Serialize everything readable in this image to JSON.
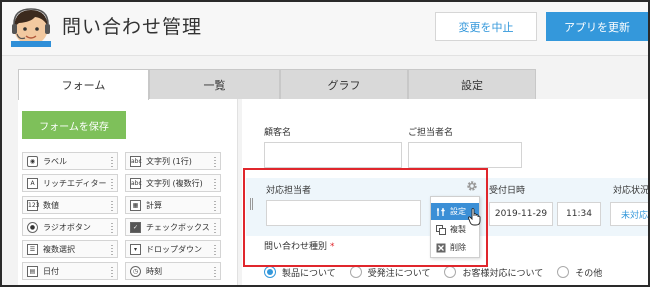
{
  "header": {
    "title": "問い合わせ管理",
    "cancel_label": "変更を中止",
    "update_label": "アプリを更新"
  },
  "tabs": [
    {
      "label": "フォーム",
      "active": true
    },
    {
      "label": "一覧",
      "active": false
    },
    {
      "label": "グラフ",
      "active": false
    },
    {
      "label": "設定",
      "active": false
    }
  ],
  "palette": {
    "save_label": "フォームを保存",
    "items": [
      {
        "label": "ラベル",
        "icon": "label-icon"
      },
      {
        "label": "文字列 (1行)",
        "icon": "abc-icon"
      },
      {
        "label": "リッチエディター",
        "icon": "rich-editor-icon"
      },
      {
        "label": "文字列 (複数行)",
        "icon": "abc-multiline-icon"
      },
      {
        "label": "数値",
        "icon": "number-icon"
      },
      {
        "label": "計算",
        "icon": "calculator-icon"
      },
      {
        "label": "ラジオボタン",
        "icon": "radio-icon"
      },
      {
        "label": "チェックボックス",
        "icon": "checkbox-icon"
      },
      {
        "label": "複数選択",
        "icon": "multi-select-icon"
      },
      {
        "label": "ドロップダウン",
        "icon": "dropdown-icon"
      },
      {
        "label": "日付",
        "icon": "calendar-icon"
      },
      {
        "label": "時刻",
        "icon": "clock-icon"
      }
    ]
  },
  "form": {
    "customer_label": "顧客名",
    "contact_label": "ご担当者名",
    "assignee_label": "対応担当者",
    "received_label": "受付日時",
    "status_label": "対応状況",
    "received_date": "2019-11-29",
    "received_time": "11:34",
    "status_value": "未対応",
    "inquiry_type_label": "問い合わせ種別",
    "required_mark": "*",
    "inquiry_options": [
      {
        "label": "製品について",
        "checked": true
      },
      {
        "label": "受発注について",
        "checked": false
      },
      {
        "label": "お客様対応について",
        "checked": false
      },
      {
        "label": "その他",
        "checked": false
      }
    ]
  },
  "context_menu": {
    "items": [
      {
        "label": "設定",
        "icon": "settings-icon"
      },
      {
        "label": "複製",
        "icon": "duplicate-icon"
      },
      {
        "label": "削除",
        "icon": "delete-icon"
      }
    ]
  },
  "colors": {
    "accent": "#3498db",
    "save_green": "#7ec05a",
    "highlight_red": "#e0262c",
    "menu_selected": "#3b8fd6"
  }
}
